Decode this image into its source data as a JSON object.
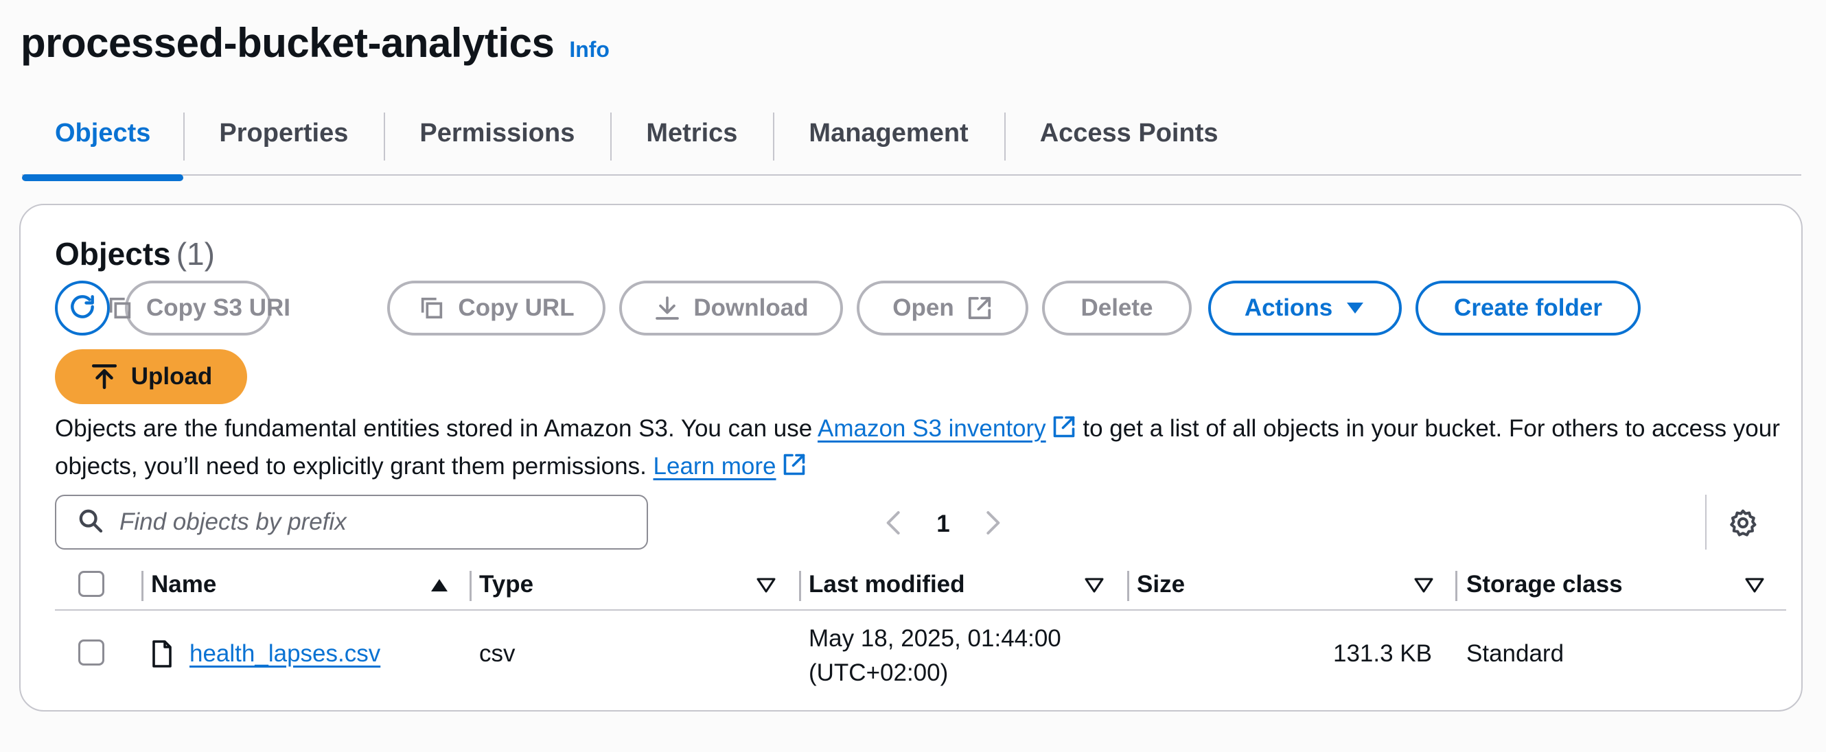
{
  "header": {
    "title": "processed-bucket-analytics",
    "info_label": "Info"
  },
  "tabs": [
    {
      "label": "Objects",
      "active": true
    },
    {
      "label": "Properties",
      "active": false
    },
    {
      "label": "Permissions",
      "active": false
    },
    {
      "label": "Metrics",
      "active": false
    },
    {
      "label": "Management",
      "active": false
    },
    {
      "label": "Access Points",
      "active": false
    }
  ],
  "objects": {
    "heading": "Objects",
    "count": "(1)",
    "toolbar": {
      "copy_s3_uri": "Copy S3 URI",
      "copy_url": "Copy URL",
      "download": "Download",
      "open": "Open",
      "delete": "Delete",
      "actions": "Actions",
      "create_folder": "Create folder",
      "upload": "Upload"
    },
    "description": {
      "part1": "Objects are the fundamental entities stored in Amazon S3. You can use ",
      "inventory_link": "Amazon S3 inventory",
      "part2": " to get a list of all objects in your bucket. For others to access your objects, you’ll need to explicitly grant them permissions. ",
      "learn_more_link": "Learn more"
    },
    "search": {
      "placeholder": "Find objects by prefix",
      "value": ""
    },
    "pagination": {
      "current_page": "1"
    },
    "table": {
      "columns": {
        "name": "Name",
        "type": "Type",
        "last_modified": "Last modified",
        "size": "Size",
        "storage_class": "Storage class"
      },
      "rows": [
        {
          "name": "health_lapses.csv",
          "type": "csv",
          "last_modified_line1": "May 18, 2025, 01:44:00",
          "last_modified_line2": "(UTC+02:00)",
          "size": "131.3 KB",
          "storage_class": "Standard"
        }
      ]
    }
  },
  "colors": {
    "accent": "#0972d3",
    "upload": "#f4a136",
    "disabled": "#8c8c94"
  },
  "icons": [
    "refresh-icon",
    "copy-icon",
    "download-icon",
    "external-link-icon",
    "caret-down-icon",
    "upload-icon",
    "search-icon",
    "chevron-left-icon",
    "chevron-right-icon",
    "gear-icon",
    "sort-ascending-icon",
    "sort-descending-icon",
    "file-icon"
  ]
}
